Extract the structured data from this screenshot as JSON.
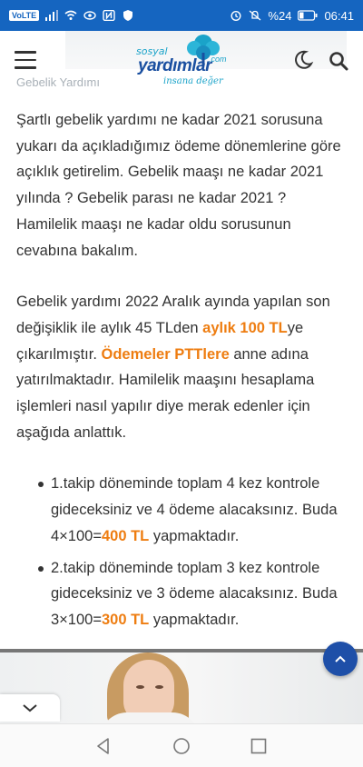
{
  "status_bar": {
    "carrier_badge": "VoLTE",
    "battery": "%24",
    "time": "06:41"
  },
  "header": {
    "faded_breadcrumb": "Gebelik Yardımı",
    "logo": {
      "top_word": "sosyal",
      "main_word": "yardımlar",
      "domain": ".com",
      "tagline": "insana değer"
    },
    "icons": [
      "menu-icon",
      "moon-icon",
      "search-icon"
    ]
  },
  "article": {
    "paragraph1": "Şartlı gebelik yardımı ne kadar 2021 sorusuna yukarı da açıkladığımız ödeme dönemlerine göre açıklık getirelim. Gebelik maaşı ne kadar 2021 yılında ? Gebelik parası ne kadar 2021 ? Hamilelik maaşı ne kadar oldu sorusunun cevabına bakalım.",
    "paragraph2": {
      "part1": "Gebelik yardımı 2022 Aralık ayında yapılan son değişiklik ile aylık 45 TLden ",
      "highlight1": "aylık 100 TL",
      "part2": "ye çıkarılmıştır. ",
      "highlight2": "Ödemeler PTTlere",
      "part3": " anne adına yatırılmaktadır. Hamilelik maaşını hesaplama işlemleri nasıl yapılır diye merak edenler için aşağıda anlattık."
    },
    "bullets": [
      {
        "text": "1.takip döneminde toplam 4 kez kontrole gideceksiniz ve 4 ödeme alacaksınız. Buda 4×100=",
        "highlight": "400 TL",
        "suffix": " yapmaktadır."
      },
      {
        "text": "2.takip döneminde toplam 3 kez kontrole gideceksiniz ve 3 ödeme alacaksınız. Buda 3×100=",
        "highlight": "300 TL",
        "suffix": " yapmaktadır."
      }
    ]
  },
  "colors": {
    "status_bar": "#1565c0",
    "highlight": "#ee7d11",
    "scroll_top_button": "#1e4fa8",
    "logo_blue": "#1a4fa0",
    "logo_cyan": "#1aa3c9"
  },
  "nav_bar": {
    "icons": [
      "back-icon",
      "home-icon",
      "recent-apps-icon"
    ]
  }
}
